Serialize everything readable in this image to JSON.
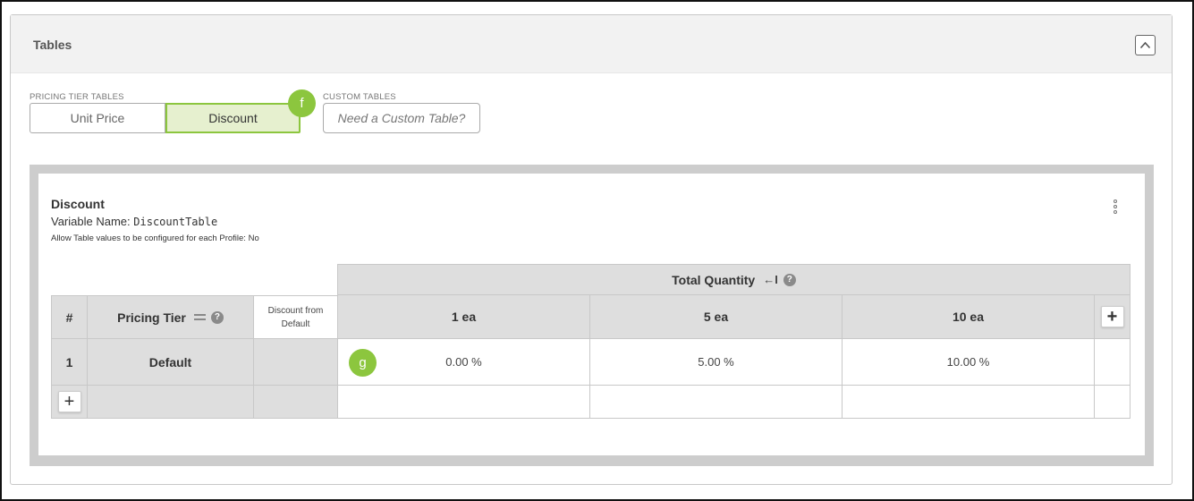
{
  "panel": {
    "title": "Tables"
  },
  "pricing_tier_tables": {
    "label": "PRICING TIER TABLES",
    "buttons": [
      "Unit Price",
      "Discount"
    ],
    "active": "Discount"
  },
  "custom_tables": {
    "label": "CUSTOM TABLES",
    "button": "Need a Custom Table?"
  },
  "markers": {
    "f": "f",
    "g": "g"
  },
  "card": {
    "title": "Discount",
    "variable_label": "Variable Name:",
    "variable_value": "DiscountTable",
    "allow_text": "Allow Table values to be configured for each Profile:",
    "allow_value": "No"
  },
  "table": {
    "group_header": "Total Quantity",
    "group_header_icon": "←I",
    "headers": {
      "num": "#",
      "tier": "Pricing Tier",
      "from_default": "Discount from Default"
    },
    "quantities": [
      "1  ea",
      "5  ea",
      "10  ea"
    ],
    "rows": [
      {
        "num": "1",
        "tier": "Default",
        "from_default": "",
        "values": [
          "0.00 %",
          "5.00 %",
          "10.00 %"
        ]
      }
    ],
    "help_glyph": "?",
    "add_glyph": "+"
  },
  "colors": {
    "accent": "#8cc63e",
    "active_bg": "#e6f0cf",
    "header_bg": "#dedede",
    "frame": "#cdcdcd"
  }
}
